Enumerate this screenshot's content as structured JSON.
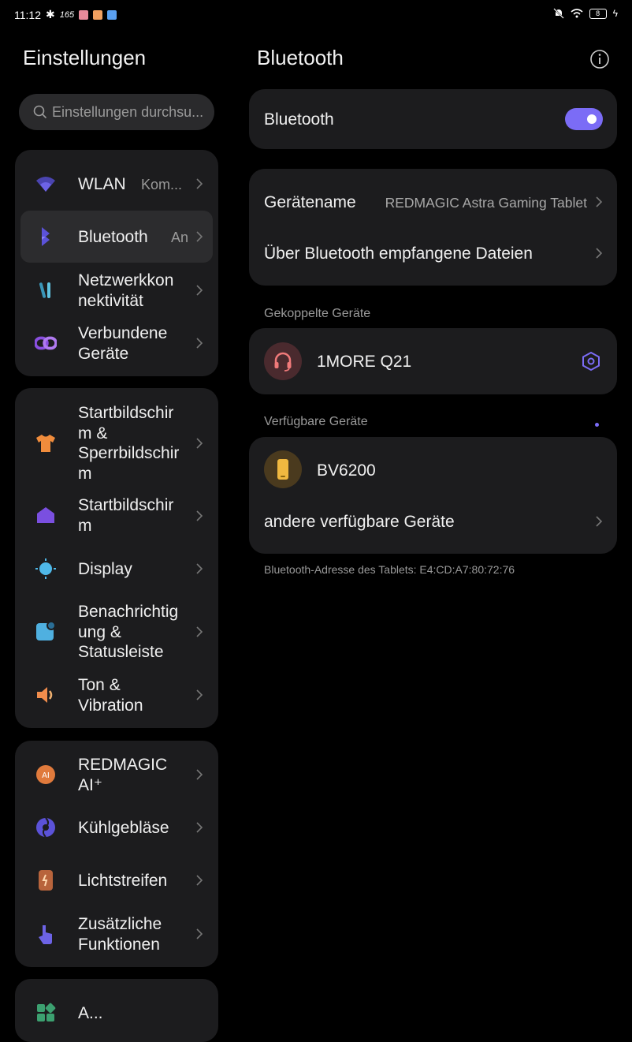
{
  "status_bar": {
    "time": "11:12",
    "speed": "165",
    "battery": "8"
  },
  "left": {
    "title": "Einstellungen",
    "search_placeholder": "Einstellungen durchsu...",
    "groups": [
      {
        "items": [
          {
            "icon": "wifi-icon",
            "label": "WLAN",
            "value": "Kom..."
          },
          {
            "icon": "bluetooth-icon",
            "label": "Bluetooth",
            "value": "An"
          },
          {
            "icon": "network-icon",
            "label": "Netzwerkkon nektivität"
          },
          {
            "icon": "link-icon",
            "label": "Verbundene Geräte"
          }
        ]
      },
      {
        "items": [
          {
            "icon": "tshirt-icon",
            "label": "Startbildschir m & Sperrbildschir m"
          },
          {
            "icon": "home-icon",
            "label": "Startbildschir m"
          },
          {
            "icon": "display-icon",
            "label": "Display"
          },
          {
            "icon": "notification-icon",
            "label": "Benachrichtig ung & Statusleiste"
          },
          {
            "icon": "speaker-icon",
            "label": "Ton & Vibration"
          }
        ]
      },
      {
        "items": [
          {
            "icon": "ai-icon",
            "label": "REDMAGIC AI⁺"
          },
          {
            "icon": "fan-icon",
            "label": "Kühlgebläse"
          },
          {
            "icon": "lightstrip-icon",
            "label": "Lichtstreifen"
          },
          {
            "icon": "touch-icon",
            "label": "Zusätzliche Funktionen"
          }
        ]
      },
      {
        "items": [
          {
            "icon": "apps-icon",
            "label": "A..."
          }
        ]
      }
    ]
  },
  "right": {
    "title": "Bluetooth",
    "bluetooth_toggle_label": "Bluetooth",
    "bluetooth_on": true,
    "device_name_label": "Gerätename",
    "device_name_value": "REDMAGIC Astra Gaming Tablet",
    "received_files_label": "Über Bluetooth empfangene Dateien",
    "paired_section": "Gekoppelte Geräte",
    "paired_devices": [
      {
        "icon": "headset-icon",
        "name": "1MORE Q21"
      }
    ],
    "available_section": "Verfügbare Geräte",
    "available_devices": [
      {
        "icon": "phone-icon",
        "name": "BV6200"
      }
    ],
    "other_devices_label": "andere verfügbare Geräte",
    "address_note": "Bluetooth-Adresse des Tablets: E4:CD:A7:80:72:76"
  },
  "colors": {
    "accent": "#7b6cf6",
    "card": "#1c1c1e",
    "background": "#000000"
  }
}
